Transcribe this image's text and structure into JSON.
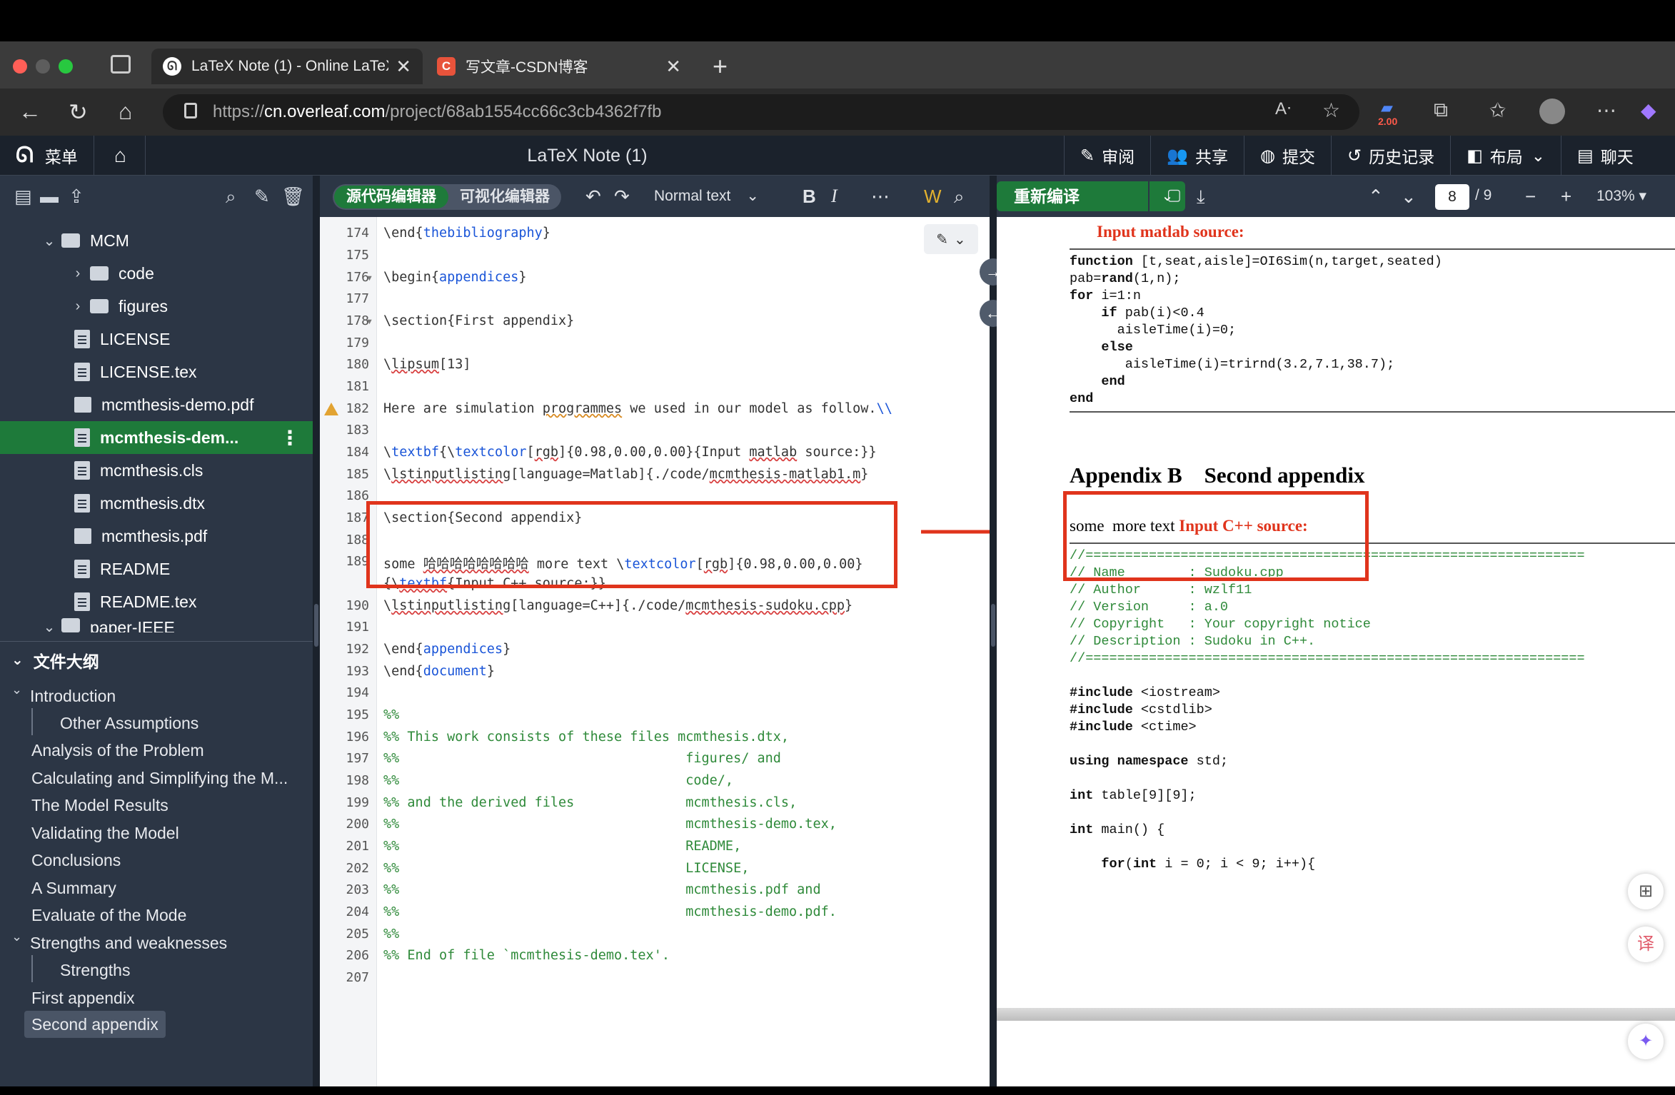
{
  "browser": {
    "tabs": [
      {
        "title": "LaTeX Note (1) - Online LaTeX E",
        "favicon": "overleaf-icon",
        "active": true
      },
      {
        "title": "写文章-CSDN博客",
        "favicon": "csdn-icon",
        "active": false
      }
    ],
    "url_prefix": "https://",
    "url_host": "cn.overleaf.com",
    "url_path": "/project/68ab1554cc66c3cb4362f7fb",
    "badge": "2.00"
  },
  "toolbar": {
    "menu_label": "菜单",
    "project_title": "LaTeX Note (1)",
    "review": "审阅",
    "share": "共享",
    "submit": "提交",
    "history": "历史记录",
    "layout": "布局",
    "chat": "聊天"
  },
  "file_tree": [
    {
      "name": "MCM",
      "type": "folder",
      "open": true,
      "level": 1
    },
    {
      "name": "code",
      "type": "folder",
      "open": false,
      "level": 2
    },
    {
      "name": "figures",
      "type": "folder",
      "open": false,
      "level": 2
    },
    {
      "name": "LICENSE",
      "type": "doc",
      "level": 2
    },
    {
      "name": "LICENSE.tex",
      "type": "doc",
      "level": 2
    },
    {
      "name": "mcmthesis-demo.pdf",
      "type": "img",
      "level": 2
    },
    {
      "name": "mcmthesis-dem...",
      "type": "doc",
      "level": 2,
      "selected": true
    },
    {
      "name": "mcmthesis.cls",
      "type": "doc",
      "level": 2
    },
    {
      "name": "mcmthesis.dtx",
      "type": "doc",
      "level": 2
    },
    {
      "name": "mcmthesis.pdf",
      "type": "img",
      "level": 2
    },
    {
      "name": "README",
      "type": "doc",
      "level": 2
    },
    {
      "name": "README.tex",
      "type": "doc",
      "level": 2
    },
    {
      "name": "paper-IEEE",
      "type": "folder",
      "level": 1
    }
  ],
  "outline": {
    "title": "文件大纲",
    "items": [
      "Introduction",
      "Other Assumptions",
      "Analysis of the Problem",
      "Calculating and Simplifying the M...",
      "The Model Results",
      "Validating the Model",
      "Conclusions",
      "A Summary",
      "Evaluate of the Mode",
      "Strengths and weaknesses",
      "Strengths",
      "First appendix",
      "Second appendix"
    ]
  },
  "editor": {
    "source_editor": "源代码编辑器",
    "visual_editor": "可视化编辑器",
    "text_style": "Normal text",
    "line_numbers": [
      "174",
      "175",
      "176",
      "177",
      "178",
      "179",
      "180",
      "181",
      "182",
      "183",
      "184",
      "185",
      "186",
      "187",
      "188",
      "189",
      "190",
      "191",
      "192",
      "193",
      "194",
      "195",
      "196",
      "197",
      "198",
      "199",
      "200",
      "201",
      "202",
      "203",
      "204",
      "205",
      "206",
      "207"
    ]
  },
  "pdf": {
    "recompile": "重新编译",
    "page": "8",
    "total_pages": "/ 9",
    "zoom": "103%",
    "heading_matlab": "Input matlab source:",
    "appendix_heading": "Appendix B    Second appendix",
    "some_text": "some  more text",
    "cpp_label": "Input C++ source:"
  }
}
